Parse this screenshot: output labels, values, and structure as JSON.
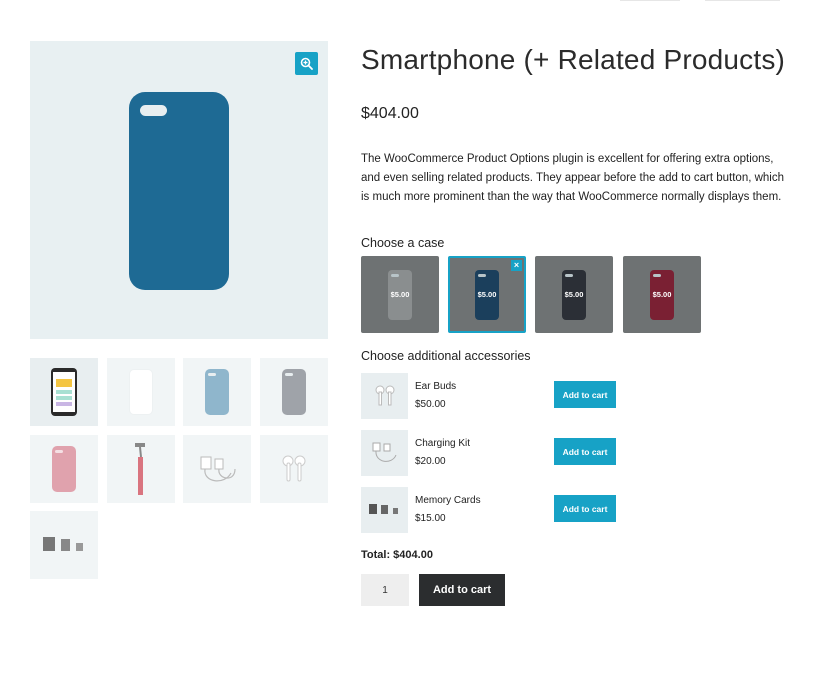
{
  "product": {
    "title": "Smartphone (+ Related Products)",
    "price": "$404.00",
    "description": "The WooCommerce Product Options plugin is excellent for offering extra options, and even selling related products. They appear before the add to cart button, which is much more prominent than the way that WooCommerce normally displays them."
  },
  "gallery": {
    "main_image": "phone-case-blue",
    "zoom_icon": "zoom-in-icon",
    "thumbnails": [
      "smartphone-screen",
      "phone-case-white",
      "phone-case-light-blue",
      "phone-case-grey",
      "phone-case-pink",
      "selfie-stick",
      "charging-kit",
      "ear-buds",
      "memory-cards"
    ]
  },
  "case_section": {
    "label": "Choose a case",
    "options": [
      {
        "price": "$5.00",
        "color": "#8a8e8f",
        "selected": false
      },
      {
        "price": "$5.00",
        "color": "#1b3f5c",
        "selected": true,
        "remove_label": "×"
      },
      {
        "price": "$5.00",
        "color": "#2b2f36",
        "selected": false
      },
      {
        "price": "$5.00",
        "color": "#7a2033",
        "selected": false
      }
    ]
  },
  "accessories_section": {
    "label": "Choose additional accessories",
    "items": [
      {
        "name": "Ear Buds",
        "price": "$50.00",
        "button": "Add to cart"
      },
      {
        "name": "Charging Kit",
        "price": "$20.00",
        "button": "Add to cart"
      },
      {
        "name": "Memory Cards",
        "price": "$15.00",
        "button": "Add to cart"
      }
    ]
  },
  "total": "Total: $404.00",
  "quantity": "1",
  "add_to_cart": "Add to cart",
  "colors": {
    "accent": "#17a2c6",
    "dark_button": "#2b2d2f",
    "phone_blue": "#1e6a94"
  }
}
